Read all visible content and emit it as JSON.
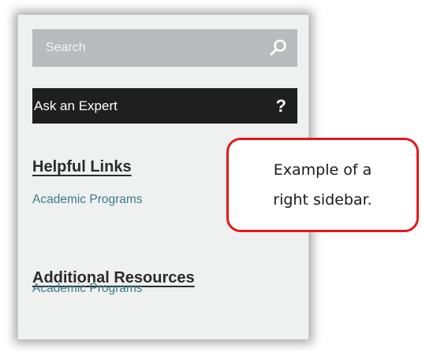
{
  "search": {
    "placeholder": "Search",
    "icon": "search-icon"
  },
  "ask_expert": {
    "label": "Ask an Expert",
    "icon_glyph": "?"
  },
  "sections": [
    {
      "heading": "Helpful Links",
      "links": [
        "Academic Programs"
      ]
    },
    {
      "heading": "Additional Resources",
      "links": [
        "Academic Programs"
      ]
    }
  ],
  "callout": {
    "line1": "Example of a",
    "line2": "right sidebar."
  },
  "colors": {
    "sidebar_bg": "#eff0f0",
    "search_bg": "#b9bbbc",
    "ask_bg": "#1f1f1f",
    "link": "#3b7d86",
    "callout_border": "#e4171b"
  }
}
